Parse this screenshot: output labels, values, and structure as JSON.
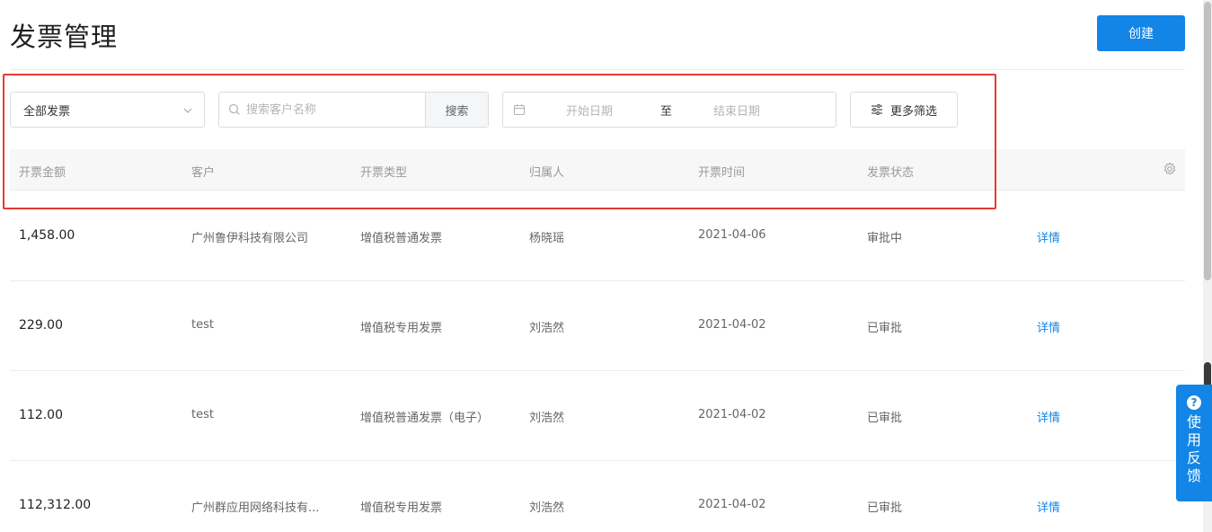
{
  "page": {
    "title": "发票管理",
    "create_label": "创建"
  },
  "filters": {
    "type_select": "全部发票",
    "search_placeholder": "搜索客户名称",
    "search_button": "搜索",
    "date_start_placeholder": "开始日期",
    "date_separator": "至",
    "date_end_placeholder": "结束日期",
    "more_filter": "更多筛选"
  },
  "table": {
    "columns": [
      "开票金额",
      "客户",
      "开票类型",
      "归属人",
      "开票时间",
      "发票状态"
    ],
    "action_label": "详情",
    "rows": [
      {
        "amount": "1,458.00",
        "customer": "广州鲁伊科技有限公司",
        "type": "增值税普通发票",
        "owner": "杨晓瑶",
        "date": "2021-04-06",
        "status": "审批中"
      },
      {
        "amount": "229.00",
        "customer": "test",
        "type": "增值税专用发票",
        "owner": "刘浩然",
        "date": "2021-04-02",
        "status": "已审批"
      },
      {
        "amount": "112.00",
        "customer": "test",
        "type": "增值税普通发票（电子）",
        "owner": "刘浩然",
        "date": "2021-04-02",
        "status": "已审批"
      },
      {
        "amount": "112,312.00",
        "customer": "广州群应用网络科技有...",
        "type": "增值税专用发票",
        "owner": "刘浩然",
        "date": "2021-04-02",
        "status": "已审批"
      }
    ]
  },
  "feedback": {
    "label": "使用反馈",
    "icon": "question-icon"
  },
  "colors": {
    "primary": "#1385e6",
    "highlight": "#e53935"
  }
}
